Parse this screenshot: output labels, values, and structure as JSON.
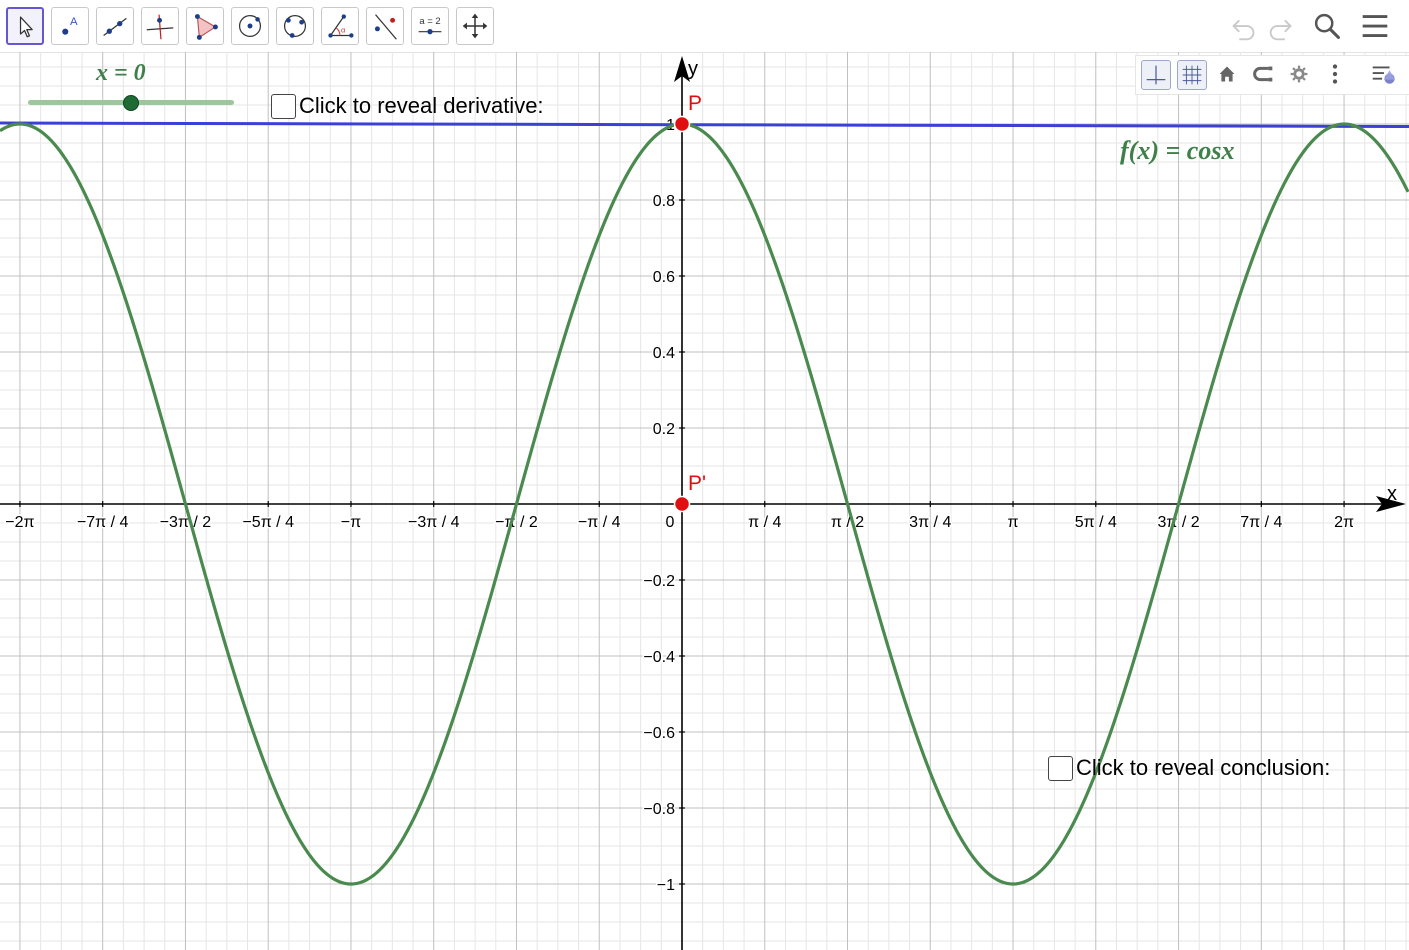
{
  "toolbar": {
    "tools": [
      {
        "icon": "move-pointer-icon",
        "active": true
      },
      {
        "icon": "point-icon",
        "active": false
      },
      {
        "icon": "line-icon",
        "active": false
      },
      {
        "icon": "perpendicular-line-icon",
        "active": false
      },
      {
        "icon": "polygon-icon",
        "active": false
      },
      {
        "icon": "circle-center-point-icon",
        "active": false
      },
      {
        "icon": "circle-three-points-icon",
        "active": false
      },
      {
        "icon": "angle-icon",
        "active": false
      },
      {
        "icon": "reflect-line-icon",
        "active": false
      },
      {
        "icon": "slider-tool-icon",
        "label": "a = 2",
        "active": false
      },
      {
        "icon": "move-graphics-view-icon",
        "active": false
      }
    ],
    "right_icons": [
      "undo-icon",
      "redo-icon",
      "search-icon",
      "menu-icon"
    ]
  },
  "style_bar": {
    "buttons": [
      "axes-toggle-icon",
      "grid-toggle-icon",
      "home-view-icon",
      "point-capture-icon",
      "graphics-settings-icon",
      "more-vert-icon",
      "toggle-style-bar-icon"
    ]
  },
  "slider": {
    "caption": "x = 0",
    "value": 0,
    "min": -10,
    "max": 10
  },
  "checkbox_derivative": {
    "label": "Click to reveal derivative:",
    "checked": false
  },
  "checkbox_conclusion": {
    "label": "Click to reveal conclusion:",
    "checked": false
  },
  "function_label": "f(x) = cosx",
  "colors": {
    "curve": "#4a8a4e",
    "tangent": "#3b40d6",
    "point": "#e01010",
    "axis": "#000000",
    "grid_major": "#c0c0c0",
    "grid_minor": "#e6e6e6",
    "accent": "#6557d2"
  },
  "chart_data": {
    "type": "line",
    "function": "cos(x)",
    "xlim": [
      -6.348,
      7.15
    ],
    "ylim": [
      -1.163,
      1.201
    ],
    "xlabel": "x",
    "ylabel": "y",
    "grid": true,
    "x_ticks": [
      {
        "value": -6.2832,
        "label": "−2π"
      },
      {
        "value": -5.4978,
        "label": "−7π / 4"
      },
      {
        "value": -4.7124,
        "label": "−3π / 2"
      },
      {
        "value": -3.927,
        "label": "−5π / 4"
      },
      {
        "value": -3.1416,
        "label": "−π"
      },
      {
        "value": -2.3562,
        "label": "−3π / 4"
      },
      {
        "value": -1.5708,
        "label": "−π / 2"
      },
      {
        "value": -0.7854,
        "label": "−π / 4"
      },
      {
        "value": 0.7854,
        "label": "π / 4"
      },
      {
        "value": 1.5708,
        "label": "π / 2"
      },
      {
        "value": 2.3562,
        "label": "3π / 4"
      },
      {
        "value": 3.1416,
        "label": "π"
      },
      {
        "value": 3.927,
        "label": "5π / 4"
      },
      {
        "value": 4.7124,
        "label": "3π / 2"
      },
      {
        "value": 5.4978,
        "label": "7π / 4"
      },
      {
        "value": 6.2832,
        "label": "2π"
      }
    ],
    "origin_label": "0",
    "y_ticks": [
      {
        "value": 1,
        "label": "1"
      },
      {
        "value": 0.8,
        "label": "0.8"
      },
      {
        "value": 0.6,
        "label": "0.6"
      },
      {
        "value": 0.4,
        "label": "0.4"
      },
      {
        "value": 0.2,
        "label": "0.2"
      },
      {
        "value": -0.2,
        "label": "−0.2"
      },
      {
        "value": -0.4,
        "label": "−0.4"
      },
      {
        "value": -0.6,
        "label": "−0.6"
      },
      {
        "value": -0.8,
        "label": "−0.8"
      },
      {
        "value": -1,
        "label": "−1"
      }
    ],
    "points": [
      {
        "name": "P",
        "x": 0,
        "y": 1
      },
      {
        "name": "P'",
        "x": 0,
        "y": 0
      }
    ],
    "tangent_line": {
      "at_x": 0,
      "slope": 0,
      "y": 1
    }
  }
}
